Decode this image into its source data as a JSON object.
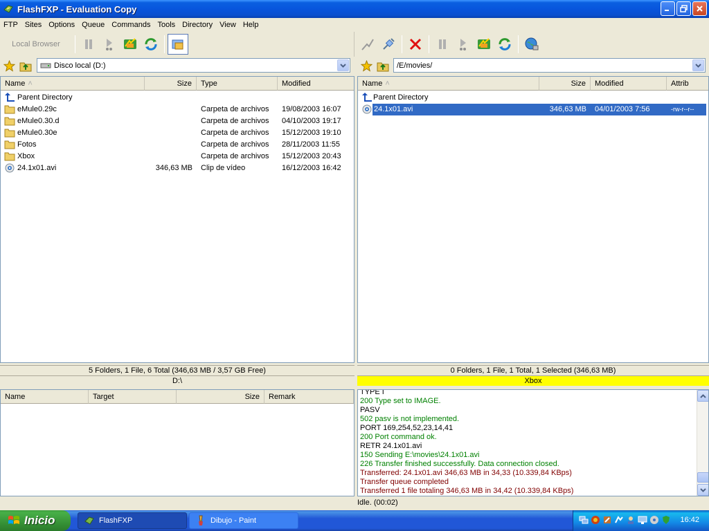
{
  "window": {
    "title": "FlashFXP - Evaluation Copy"
  },
  "menu": [
    "FTP",
    "Sites",
    "Options",
    "Queue",
    "Commands",
    "Tools",
    "Directory",
    "View",
    "Help"
  ],
  "toolbar_left": {
    "local_browser_label": "Local Browser"
  },
  "address": {
    "local": "Disco local (D:)",
    "remote": "/E/movies/"
  },
  "local_pane": {
    "columns": [
      "Name",
      "Size",
      "Type",
      "Modified"
    ],
    "parent": "Parent Directory",
    "rows": [
      {
        "name": "eMule0.29c",
        "size": "",
        "type": "Carpeta de archivos",
        "modified": "19/08/2003 16:07",
        "icon": "folder-icon"
      },
      {
        "name": "eMule0.30.d",
        "size": "",
        "type": "Carpeta de archivos",
        "modified": "04/10/2003 19:17",
        "icon": "folder-icon"
      },
      {
        "name": "eMule0.30e",
        "size": "",
        "type": "Carpeta de archivos",
        "modified": "15/12/2003 19:10",
        "icon": "folder-icon"
      },
      {
        "name": "Fotos",
        "size": "",
        "type": "Carpeta de archivos",
        "modified": "28/11/2003 11:55",
        "icon": "folder-icon"
      },
      {
        "name": "Xbox",
        "size": "",
        "type": "Carpeta de archivos",
        "modified": "15/12/2003 20:43",
        "icon": "folder-icon"
      },
      {
        "name": "24.1x01.avi",
        "size": "346,63 MB",
        "type": "Clip de vídeo",
        "modified": "16/12/2003 16:42",
        "icon": "video-file-icon"
      }
    ],
    "status": "5 Folders, 1 File, 6 Total (346,63 MB / 3,57 GB Free)",
    "path": "D:\\"
  },
  "remote_pane": {
    "columns": [
      "Name",
      "Size",
      "Modified",
      "Attrib"
    ],
    "parent": "Parent Directory",
    "rows": [
      {
        "name": "24.1x01.avi",
        "size": "346,63 MB",
        "modified": "04/01/2003 7:56",
        "attrib": "-rw-r--r--",
        "selected": true
      }
    ],
    "status": "0 Folders, 1 File, 1 Total, 1 Selected (346,63 MB)",
    "site": "Xbox"
  },
  "queue": {
    "columns": [
      "Name",
      "Target",
      "Size",
      "Remark"
    ]
  },
  "log": [
    {
      "text": "TYPE I",
      "color": "black"
    },
    {
      "text": "200 Type set to IMAGE.",
      "color": "green"
    },
    {
      "text": "PASV",
      "color": "black"
    },
    {
      "text": "502 pasv is not implemented.",
      "color": "green"
    },
    {
      "text": "PORT 169,254,52,23,14,41",
      "color": "black"
    },
    {
      "text": "200 Port command ok.",
      "color": "green"
    },
    {
      "text": "RETR 24.1x01.avi",
      "color": "black"
    },
    {
      "text": "150 Sending E:\\movies\\24.1x01.avi",
      "color": "green"
    },
    {
      "text": "226 Transfer finished successfully. Data connection closed.",
      "color": "green"
    },
    {
      "text": "Transferred: 24.1x01.avi 346,63 MB in 34,33 (10.339,84 KBps)",
      "color": "maroon"
    },
    {
      "text": "Transfer queue completed",
      "color": "maroon"
    },
    {
      "text": "Transferred 1 file totaling 346,63 MB in 34,42 (10.339,84 KBps)",
      "color": "maroon"
    }
  ],
  "idle_status": "Idle. (00:02)",
  "taskbar": {
    "start": "Inicio",
    "tasks": [
      "FlashFXP",
      "Dibujo - Paint"
    ],
    "clock": "16:42"
  },
  "colors": {
    "selection": "#316ac5",
    "site_highlight": "#ffff00",
    "log_green": "#008000",
    "log_maroon": "#800000"
  }
}
